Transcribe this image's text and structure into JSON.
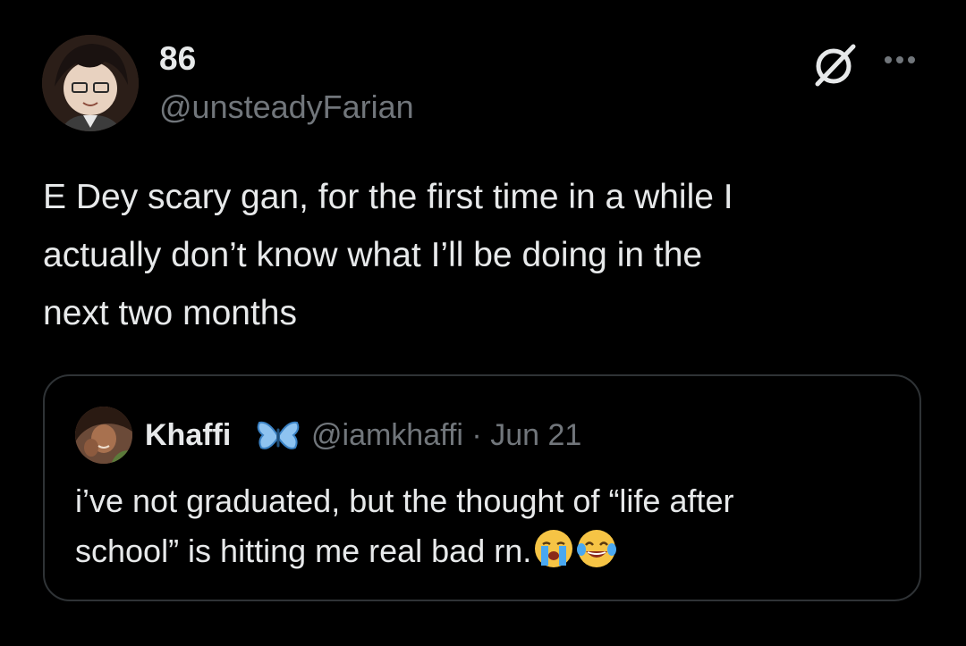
{
  "author": {
    "display_name": "86",
    "handle": "@unsteadyFarian",
    "avatar_icon": "anime-character-avatar"
  },
  "actions": {
    "grok_icon": "grok-icon",
    "more_icon": "more-options-icon"
  },
  "tweet": {
    "text": "E Dey scary gan, for the first time in a while I\nactually don’t know what I’ll be doing in the\nnext two months"
  },
  "quoted_tweet": {
    "display_name": "Khaffi",
    "badge_icon": "butterfly-emoji",
    "handle": "@iamkhaffi",
    "separator": "·",
    "date": "Jun 21",
    "text_line1": "i’ve not graduated, but the thought of “life after",
    "text_line2": "school” is hitting me real bad rn.",
    "emojis": [
      "loudly-crying-face-emoji",
      "face-with-tears-of-joy-emoji"
    ]
  },
  "colors": {
    "background": "#000000",
    "primary_text": "#e7e9ea",
    "secondary_text": "#71767b",
    "border": "#2f3336",
    "butterfly": "#8ec3f0"
  }
}
